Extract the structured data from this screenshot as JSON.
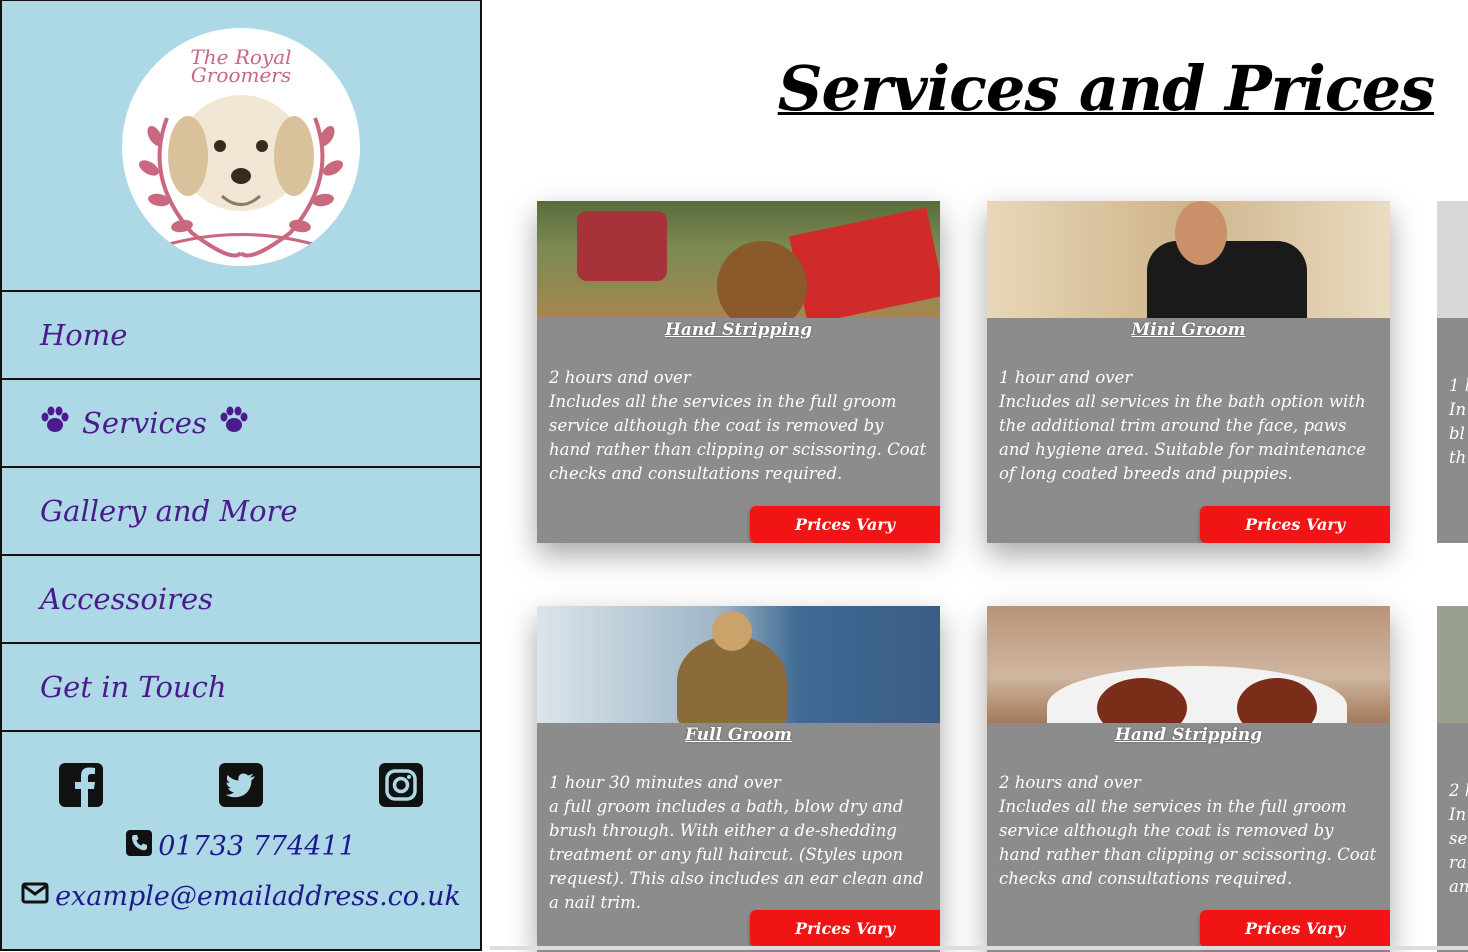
{
  "sidebar": {
    "logo_text_line1": "The Royal",
    "logo_text_line2": "Groomers",
    "nav": [
      {
        "label": "Home"
      },
      {
        "label": "Services"
      },
      {
        "label": "Gallery and More"
      },
      {
        "label": "Accessoires"
      },
      {
        "label": "Get in Touch"
      }
    ],
    "phone": "01733 774411",
    "email": "example@emailaddress.co.uk"
  },
  "main": {
    "title": "Services and Prices",
    "cards": [
      {
        "title": "Hand Stripping",
        "duration": "2 hours and over",
        "description": "Includes all the services in the full groom service although the coat is removed by hand rather than clipping or scissoring. Coat checks and consultations required.",
        "price": "Prices Vary"
      },
      {
        "title": "Mini Groom",
        "duration": "1 hour and over",
        "description": "Includes all services in the bath option with the additional trim around the face, paws and hygiene area. Suitable for maintenance of long coated breeds and puppies.",
        "price": "Prices Vary"
      },
      {
        "title": "Full Groom",
        "duration": "1 hour 30 minutes and over",
        "description": "a full groom includes a bath, blow dry and brush through. With either a de-shedding treatment or any full haircut. (Styles upon request). This also includes an ear clean and a nail trim.",
        "price": "Prices Vary"
      },
      {
        "title": "Hand Stripping",
        "duration": "2 hours and over",
        "description": "Includes all the services in the full groom service although the coat is removed by hand rather than clipping or scissoring. Coat checks and consultations required.",
        "price": "Prices Vary"
      }
    ],
    "partial_cards": [
      {
        "text": "1 h\nIn\nbl\nth"
      },
      {
        "text": "2 h\nIn\nse\nra\nan"
      }
    ]
  },
  "colors": {
    "sidebar_bg": "#add8e6",
    "nav_text": "#4b1a8c",
    "price_button": "#f01414",
    "card_overlay": "#8c8c8c"
  },
  "icons": [
    "paw-icon",
    "facebook-icon",
    "twitter-icon",
    "instagram-icon",
    "phone-icon",
    "envelope-icon"
  ]
}
